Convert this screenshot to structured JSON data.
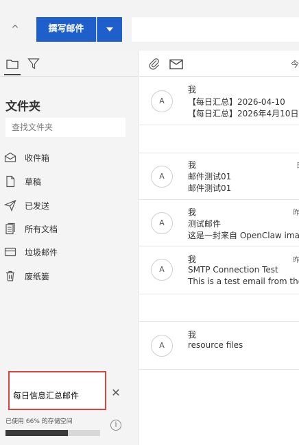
{
  "toolbar": {
    "collapse_glyph": "^",
    "compose_label": "撰写邮件"
  },
  "sidebar": {
    "title": "文件夹",
    "find_placeholder": "查找文件夹",
    "folders": [
      {
        "label": "收件箱",
        "icon": "inbox-icon"
      },
      {
        "label": "草稿",
        "icon": "draft-icon"
      },
      {
        "label": "已发送",
        "icon": "sent-icon"
      },
      {
        "label": "所有文档",
        "icon": "documents-icon"
      },
      {
        "label": "垃圾邮件",
        "icon": "junk-icon"
      },
      {
        "label": "废纸篓",
        "icon": "trash-icon"
      }
    ],
    "search_tag": {
      "text": "每日信息汇总邮件",
      "close_glyph": "✕"
    },
    "storage": {
      "text": "已使用 66% 的存储空间",
      "used_fraction": 0.66,
      "info_glyph": "i"
    }
  },
  "list": {
    "header_date": "今",
    "messages": [
      {
        "avatar": "A",
        "sender": "我",
        "subject": "【每日汇总】2026-04-10",
        "preview": "【每日汇总】2026年4月10日",
        "date": ""
      },
      {
        "avatar": "A",
        "sender": "我",
        "subject": "邮件测试01",
        "preview": "邮件测试01",
        "date": "日"
      },
      {
        "avatar": "A",
        "sender": "我",
        "subject": "测试邮件",
        "preview": "这是一封来自 OpenClaw ima",
        "date": "昨"
      },
      {
        "avatar": "A",
        "sender": "我",
        "subject": "SMTP Connection Test",
        "preview": "This is a test email from the",
        "date": "昨"
      },
      {
        "avatar": "A",
        "sender": "我",
        "subject": "resource files",
        "preview": "",
        "date": ""
      }
    ]
  },
  "colors": {
    "accent": "#1f5fcc",
    "highlight_border": "#d9453d",
    "sidebar_bg": "#f4f4f4"
  }
}
